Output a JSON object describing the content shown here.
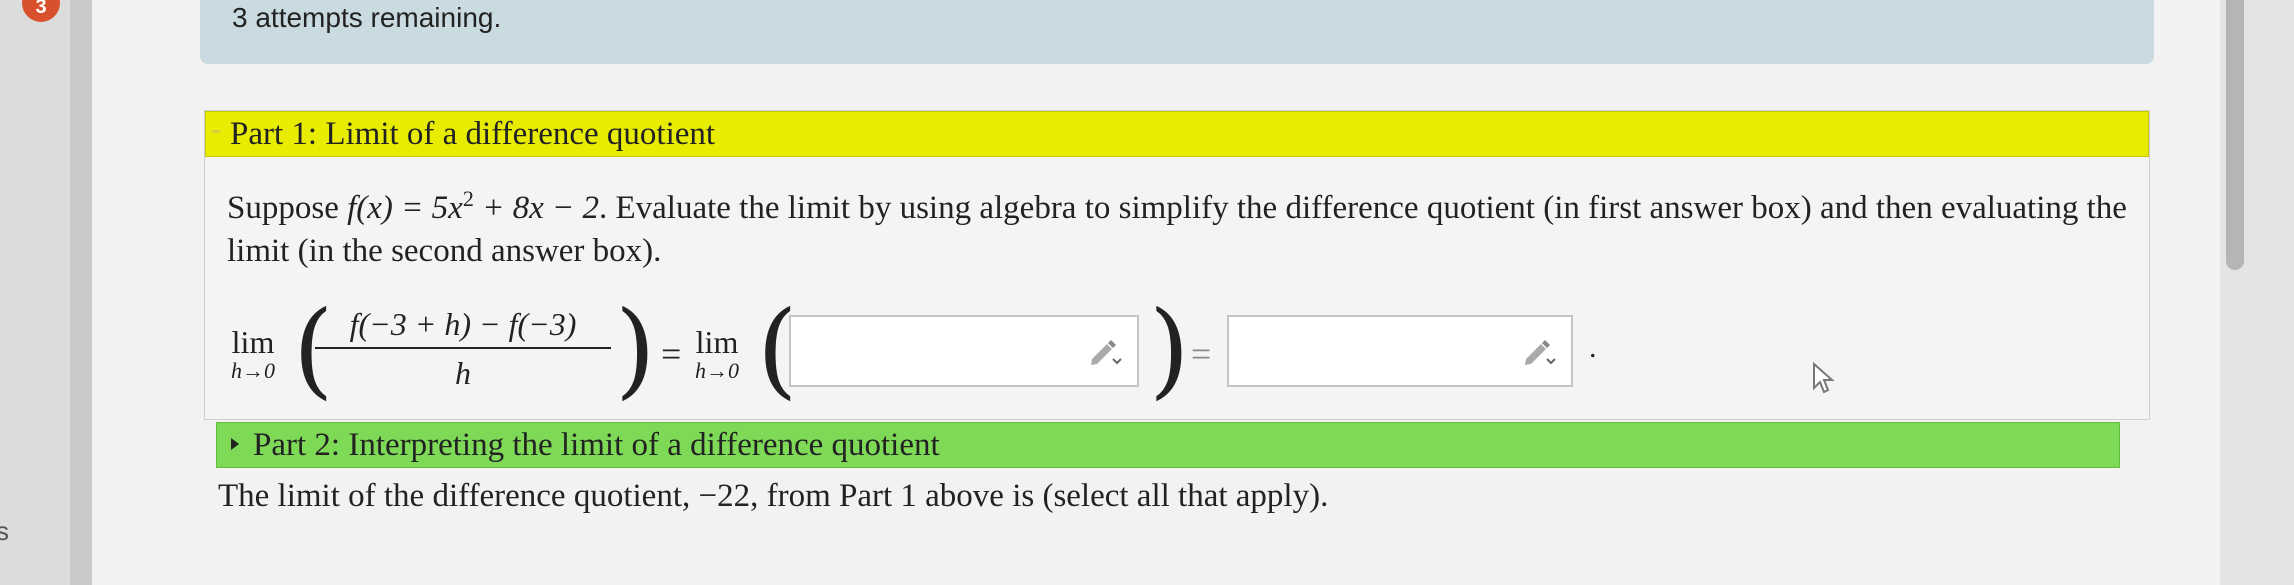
{
  "badge": {
    "count": "3"
  },
  "sidebar": {
    "letter": "s"
  },
  "attempts": {
    "text": "3 attempts remaining."
  },
  "part1": {
    "title": "Part 1: Limit of a difference quotient",
    "question_prefix": "Suppose ",
    "function": "f(x) = 5x",
    "exponent": "2",
    "function_rest": " + 8x − 2",
    "question_text": ". Evaluate the limit by using algebra to simplify the difference quotient (in first answer box) and then evaluating the limit (in the second answer box).",
    "limit_word": "lim",
    "limit_sub": "h→0",
    "numerator": "f(−3 + h) − f(−3)",
    "denominator": "h",
    "equals": "=",
    "period": ".",
    "answer1": {
      "value": ""
    },
    "answer2": {
      "value": ""
    }
  },
  "part2": {
    "title": "Part 2: Interpreting the limit of a difference quotient",
    "text": "The limit of the difference quotient, −22, from Part 1 above is (select all that apply)."
  },
  "colors": {
    "part1_header": "#e8ec00",
    "part2_header": "#7ed957",
    "attempts_bg": "#c9dbe0",
    "badge": "#d9512c"
  },
  "icons": [
    "pencil-edit-icon",
    "chevron-right-icon",
    "mouse-cursor-icon"
  ]
}
